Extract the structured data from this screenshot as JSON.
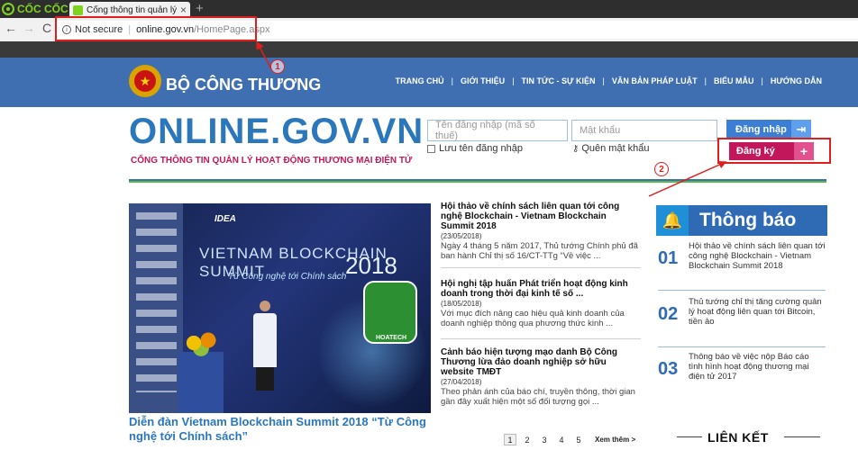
{
  "browser": {
    "brand": "CỐC CỐC",
    "tab_title": "Cổng thông tin quản lý hoạt",
    "tab_close": "×",
    "new_tab": "+",
    "back": "←",
    "forward": "→",
    "reload": "C",
    "security_label": "Not secure",
    "url_host": "online.gov.vn",
    "url_path": "/HomePage.aspx"
  },
  "header": {
    "ministry": "BỘ CÔNG THƯƠNG",
    "nav": [
      "TRANG CHỦ",
      "GIỚI THIỆU",
      "TIN TỨC - SỰ KIỆN",
      "VĂN BẢN PHÁP LUẬT",
      "BIỂU MẪU",
      "HƯỚNG DẪN"
    ]
  },
  "site": {
    "logo": "ONLINE.GOV.VN",
    "tagline": "CỔNG THÔNG TIN QUẢN LÝ HOẠT ĐỘNG THƯƠNG MẠI ĐIỆN TỬ"
  },
  "login": {
    "username_placeholder": "Tên đăng nhập (mã số thuế)",
    "password_placeholder": "Mật khẩu",
    "remember_label": "Lưu tên đăng nhập",
    "forgot_label": "Quên mật khẩu",
    "login_button": "Đăng nhập",
    "register_button": "Đăng ký"
  },
  "annotations": {
    "badge_1": "1",
    "badge_2": "2",
    "color": "#e21d1d"
  },
  "banner": {
    "idea": "IDEA",
    "title": "VIETNAM BLOCKCHAIN SUMMIT",
    "subtitle": "Từ Công nghệ tới Chính sách",
    "year": "2018",
    "watermark": "HOATECH",
    "caption": "Diễn đàn Vietnam Blockchain Summit 2018 “Từ Công nghệ tới Chính sách”"
  },
  "news": [
    {
      "title": "Hội thảo về chính sách liên quan tới công nghệ Blockchain - Vietnam Blockchain Summit 2018",
      "date": "(23/05/2018)",
      "summary": "Ngày 4 tháng 5 năm 2017, Thủ tướng Chính phủ đã ban hành Chỉ thị số 16/CT-TTg “Về việc ..."
    },
    {
      "title": "Hội nghị tập huấn Phát triển hoạt động kinh doanh trong thời đại kinh tế số ...",
      "date": "(18/05/2018)",
      "summary": "Với mục đích nâng cao hiệu quả kinh doanh của doanh nghiệp thông qua phương thức kinh ..."
    },
    {
      "title": "Cảnh báo hiện tượng mạo danh Bộ Công Thương lừa đảo doanh nghiệp sở hữu website TMĐT",
      "date": "(27/04/2018)",
      "summary": "Theo phản ánh của báo chí, truyền thông, thời gian gần đây xuất hiện một số đối tượng gọi ..."
    }
  ],
  "pagination": {
    "pages": [
      "1",
      "2",
      "3",
      "4",
      "5"
    ],
    "active": "1",
    "more": "Xem thêm >"
  },
  "notices": {
    "title": "Thông báo",
    "items": [
      {
        "num": "01",
        "text": "Hội thảo về chính sách liên quan tới công nghệ Blockchain - Vietnam Blockchain Summit 2018"
      },
      {
        "num": "02",
        "text": "Thủ tướng chỉ thị tăng cường quản lý hoạt động liên quan tới Bitcoin, tiền ảo"
      },
      {
        "num": "03",
        "text": "Thông báo về việc nộp Báo cáo tình hình hoạt động thương mại điện tử 2017"
      }
    ]
  },
  "links_title": "LIÊN KẾT"
}
